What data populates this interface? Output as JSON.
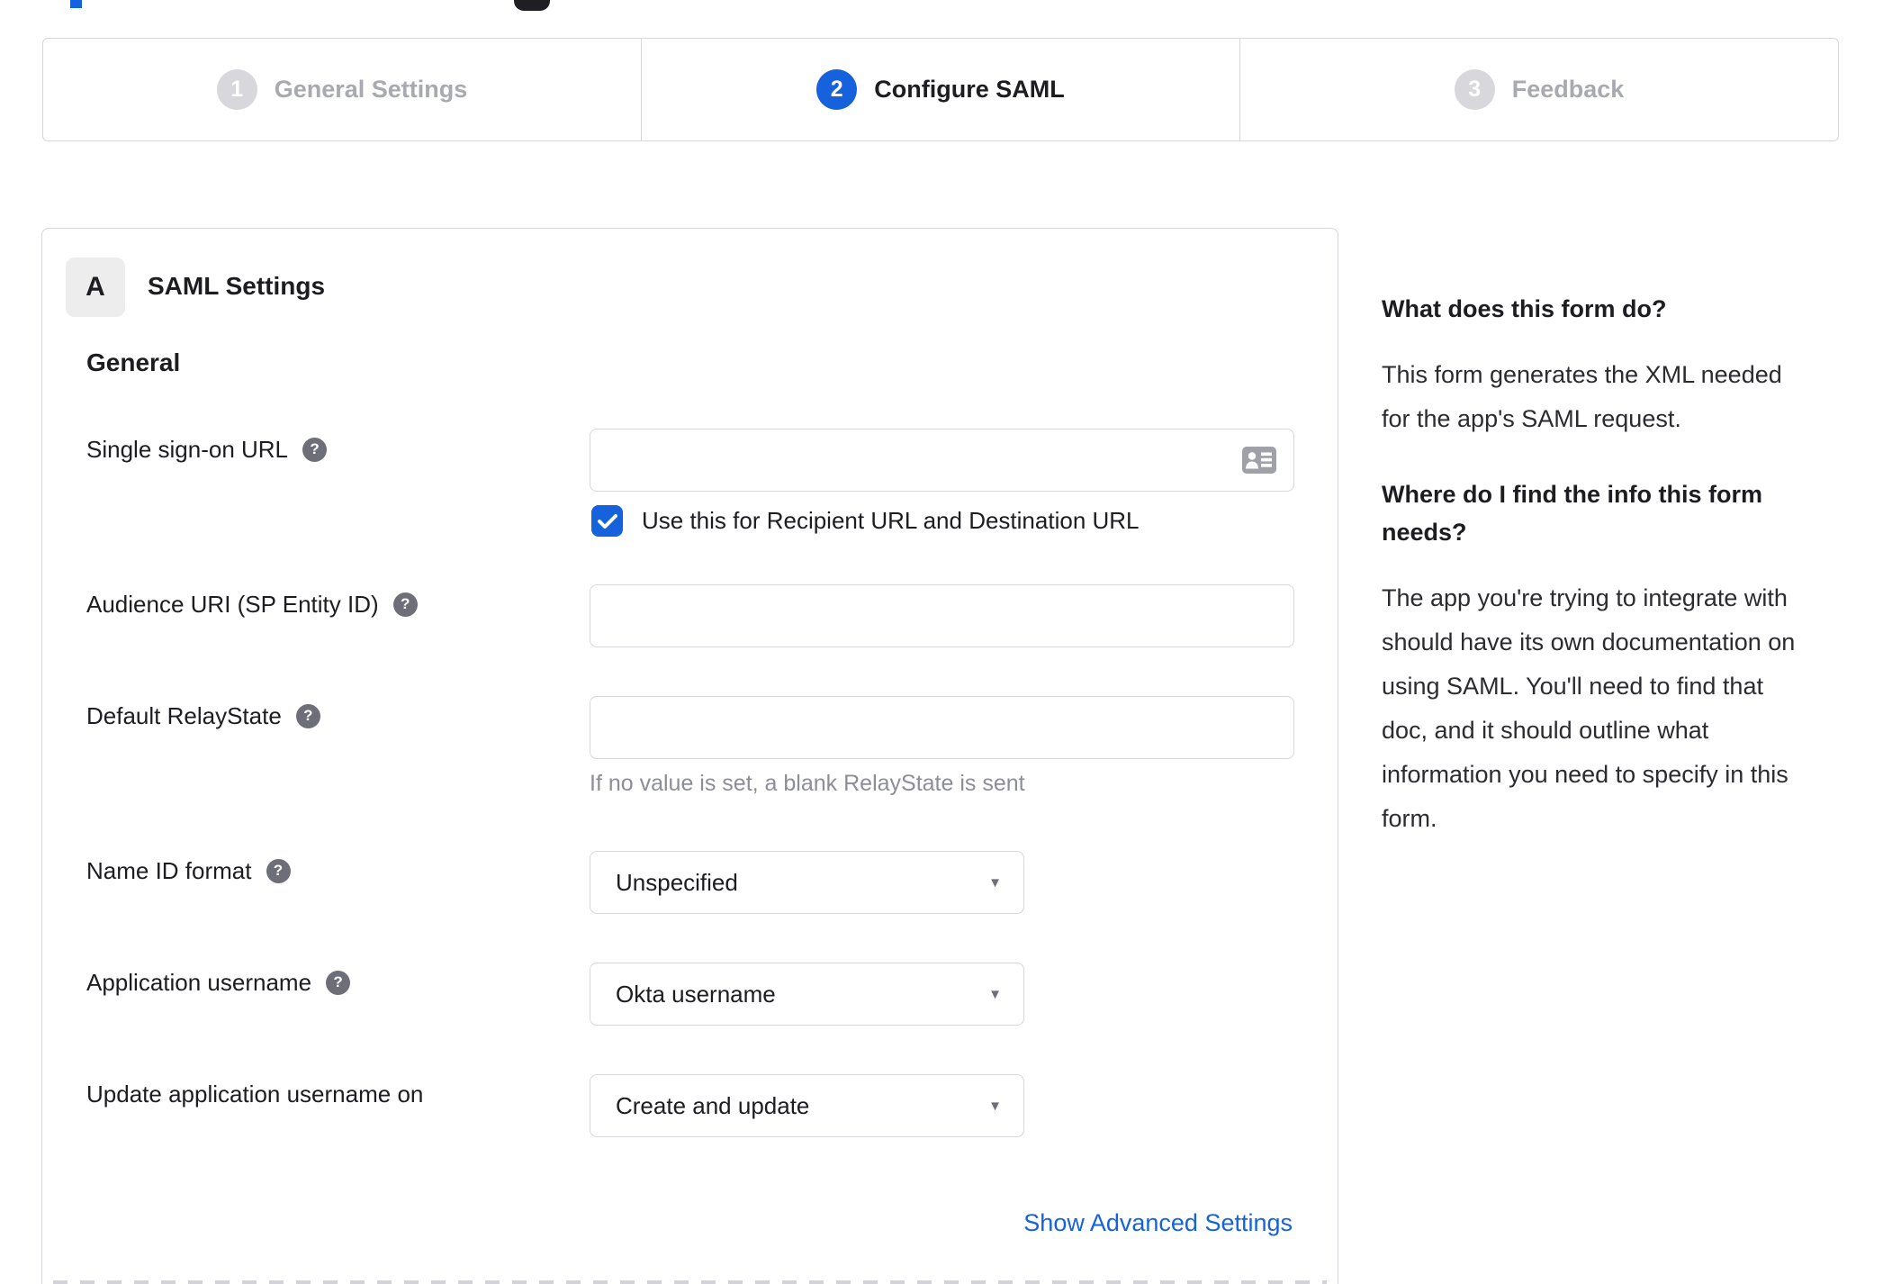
{
  "colors": {
    "accent": "#1662dd",
    "border": "#d7d7dc",
    "text": "#1d1d21",
    "muted": "#8d8d99",
    "inactive_step": "#a9a9b1"
  },
  "stepper": {
    "steps": [
      {
        "number": "1",
        "label": "General Settings",
        "state": "inactive"
      },
      {
        "number": "2",
        "label": "Configure SAML",
        "state": "active"
      },
      {
        "number": "3",
        "label": "Feedback",
        "state": "inactive"
      }
    ]
  },
  "panel": {
    "badge": "A",
    "title": "SAML Settings",
    "group": "General",
    "fields": [
      {
        "label": "Single sign-on URL",
        "value": "",
        "icon": "contact-card-icon"
      },
      {
        "label": "Audience URI (SP Entity ID)",
        "value": ""
      },
      {
        "label": "Default RelayState",
        "value": "",
        "hint": "If no value is set, a blank RelayState is sent"
      },
      {
        "label": "Name ID format",
        "value": "Unspecified"
      },
      {
        "label": "Application username",
        "value": "Okta username"
      },
      {
        "label": "Update application username on",
        "value": "Create and update"
      }
    ],
    "checkbox": {
      "checked": true,
      "label": "Use this for Recipient URL and Destination URL"
    },
    "advanced_link": "Show Advanced Settings"
  },
  "sidebar": {
    "q1": "What does this form do?",
    "a1": "This form generates the XML needed\nfor the app's SAML request.",
    "q2": "Where do I find the info this form\nneeds?",
    "a2": "The app you're trying to integrate with\nshould have its own documentation on\nusing SAML. You'll need to find that\ndoc, and it should outline what\ninformation you need to specify in this\nform."
  }
}
